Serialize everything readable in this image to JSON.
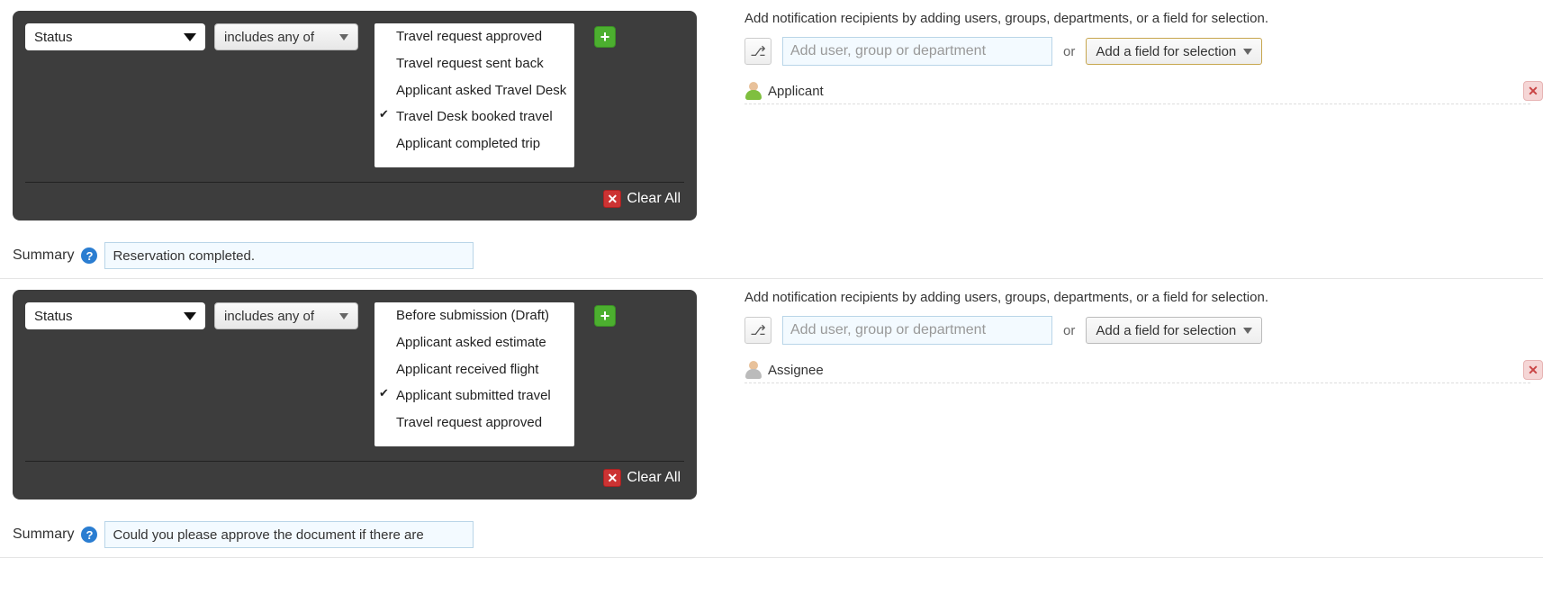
{
  "condition1": {
    "field": "Status",
    "operator": "includes any of",
    "options": [
      {
        "label": "Travel request approved",
        "checked": false
      },
      {
        "label": "Travel request sent back",
        "checked": false
      },
      {
        "label": "Applicant asked Travel Desk",
        "checked": false
      },
      {
        "label": "Travel Desk booked travel",
        "checked": true
      },
      {
        "label": "Applicant completed trip",
        "checked": false
      }
    ],
    "clear_label": "Clear All",
    "summary_label": "Summary",
    "summary_value": "Reservation completed."
  },
  "right1": {
    "instruction": "Add notification recipients by adding users, groups, departments, or a field for selection.",
    "input_placeholder": "Add user, group or department",
    "or_label": "or",
    "field_btn": "Add a field for selection",
    "recipient": "Applicant"
  },
  "condition2": {
    "field": "Status",
    "operator": "includes any of",
    "options": [
      {
        "label": "Before submission (Draft)",
        "checked": false
      },
      {
        "label": "Applicant asked estimate",
        "checked": false
      },
      {
        "label": "Applicant received flight",
        "checked": false
      },
      {
        "label": "Applicant submitted travel",
        "checked": true
      },
      {
        "label": "Travel request approved",
        "checked": false
      }
    ],
    "clear_label": "Clear All",
    "summary_label": "Summary",
    "summary_value": "Could you please approve the document if there are"
  },
  "right2": {
    "instruction": "Add notification recipients by adding users, groups, departments, or a field for selection.",
    "input_placeholder": "Add user, group or department",
    "or_label": "or",
    "field_btn": "Add a field for selection",
    "recipient": "Assignee"
  }
}
